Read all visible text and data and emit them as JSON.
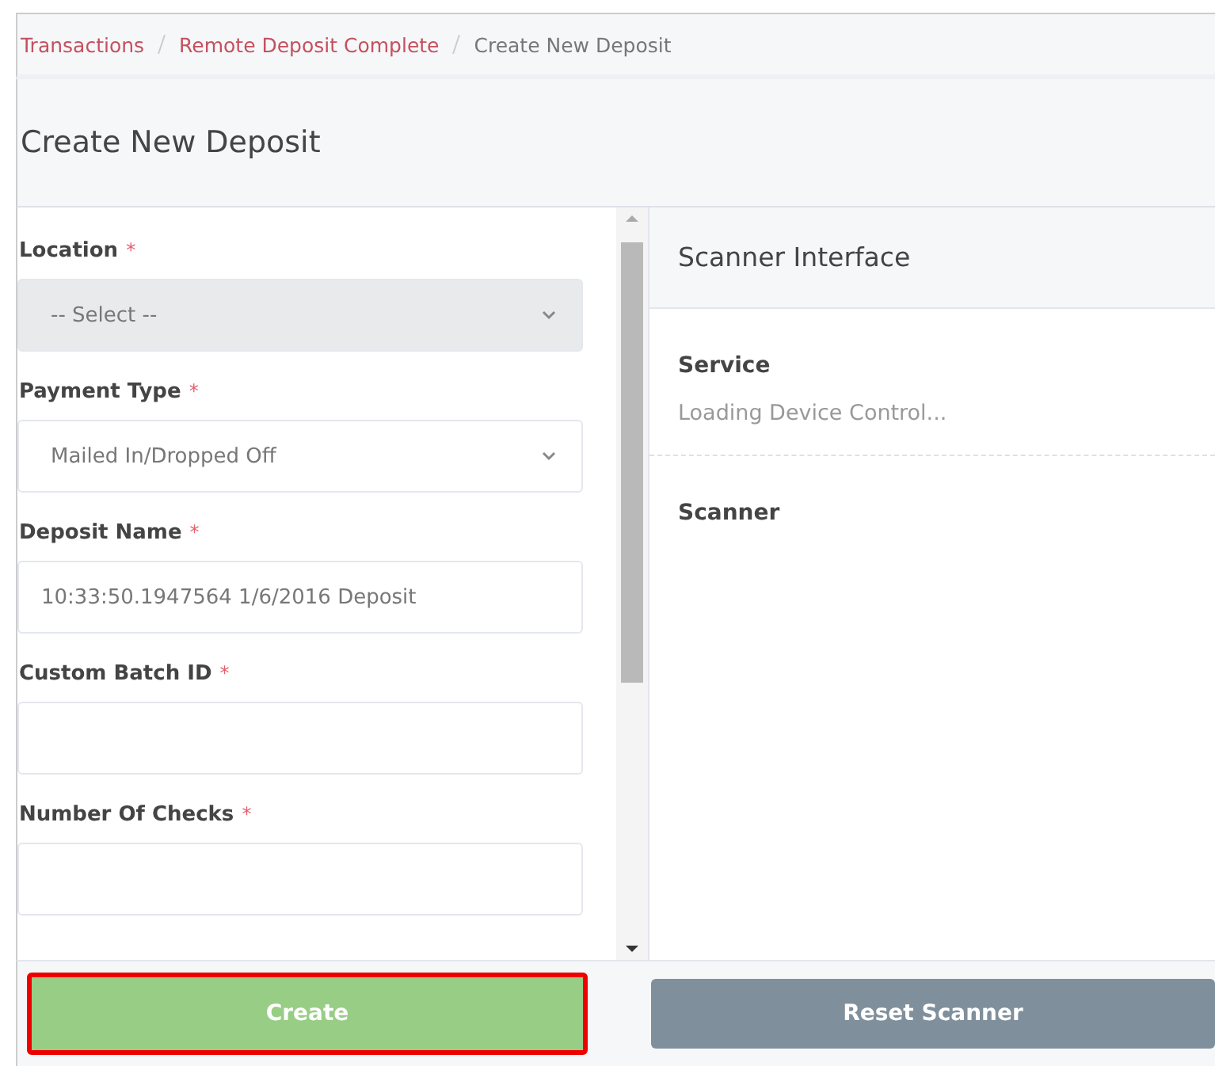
{
  "breadcrumbs": [
    {
      "label": "Transactions",
      "link": true
    },
    {
      "label": "Remote Deposit Complete",
      "link": true
    },
    {
      "label": "Create New Deposit",
      "link": false
    }
  ],
  "page_title": "Create New Deposit",
  "form": {
    "fields": [
      {
        "kind": "select",
        "label": "Location",
        "required_mark": "*",
        "value": "-- Select --",
        "disabled": true
      },
      {
        "kind": "select",
        "label": "Payment Type",
        "required_mark": "*",
        "value": "Mailed In/Dropped Off",
        "disabled": false
      },
      {
        "kind": "input",
        "label": "Deposit Name",
        "required_mark": "*",
        "value": "10:33:50.1947564 1/6/2016 Deposit"
      },
      {
        "kind": "input",
        "label": "Custom Batch ID",
        "required_mark": "*"
      },
      {
        "kind": "input",
        "label": "Number Of Checks",
        "required_mark": "*"
      }
    ]
  },
  "scanner": {
    "title": "Scanner Interface",
    "sections": [
      {
        "heading": "Service",
        "text": "Loading Device Control..."
      },
      {
        "heading": "Scanner"
      }
    ]
  },
  "buttons": [
    {
      "label": "Create",
      "kind": "primary",
      "highlighted": true
    },
    {
      "label": "Reset Scanner",
      "kind": "secondary",
      "highlighted": false
    }
  ]
}
